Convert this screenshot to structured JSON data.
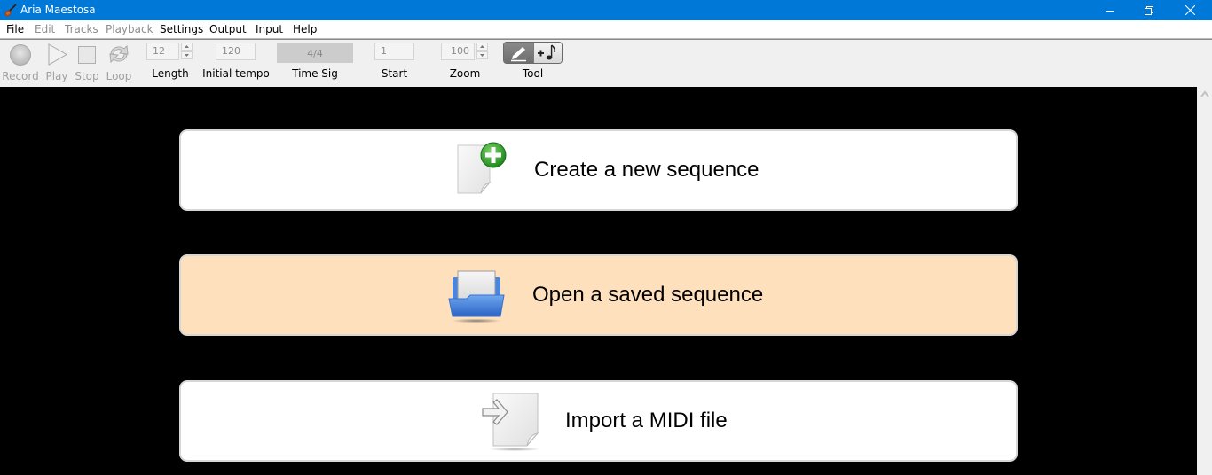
{
  "window": {
    "title": "Aria Maestosa",
    "app_icon": "violin-icon",
    "controls": [
      "minimize",
      "restore",
      "close"
    ]
  },
  "menu": {
    "items": [
      {
        "label": "File",
        "enabled": true
      },
      {
        "label": "Edit",
        "enabled": false
      },
      {
        "label": "Tracks",
        "enabled": false
      },
      {
        "label": "Playback",
        "enabled": false
      },
      {
        "label": "Settings",
        "enabled": true
      },
      {
        "label": "Output",
        "enabled": true
      },
      {
        "label": "Input",
        "enabled": true
      },
      {
        "label": "Help",
        "enabled": true
      }
    ]
  },
  "toolbar": {
    "record_label": "Record",
    "play_label": "Play",
    "stop_label": "Stop",
    "loop_label": "Loop",
    "length": {
      "value": "12",
      "label": "Length"
    },
    "tempo": {
      "value": "120",
      "label": "Initial tempo"
    },
    "timesig": {
      "value": "4/4",
      "label": "Time Sig"
    },
    "start": {
      "value": "1",
      "label": "Start"
    },
    "zoom": {
      "value": "100",
      "label": "Zoom"
    },
    "tool": {
      "label": "Tool",
      "options": [
        "pencil",
        "add-note"
      ],
      "selected": "pencil"
    }
  },
  "welcome": {
    "cards": [
      {
        "label": "Create a new sequence",
        "icon": "new-document-icon",
        "highlighted": false
      },
      {
        "label": "Open a saved sequence",
        "icon": "open-folder-icon",
        "highlighted": true
      },
      {
        "label": "Import a MIDI file",
        "icon": "import-file-icon",
        "highlighted": false
      }
    ],
    "colors": {
      "card": "#ffffff",
      "card_highlight": "#ffe0bd",
      "background": "#000000"
    }
  }
}
